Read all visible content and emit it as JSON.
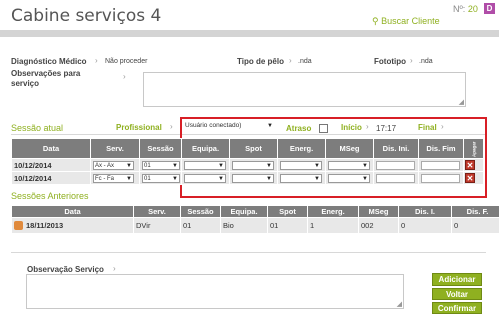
{
  "header": {
    "title": "Cabine serviços 4",
    "search_label": "Buscar Cliente",
    "no_label": "Nº:",
    "no_value": "20",
    "badge": "D"
  },
  "info": {
    "diag_label": "Diagnóstico Médico",
    "diag_value": "Não proceder",
    "tipo_label": "Tipo de pêlo",
    "tipo_value": ".nda",
    "foto_label": "Fototipo",
    "foto_value": ".nda",
    "obs_label_1": "Observações para",
    "obs_label_2": "serviço"
  },
  "session": {
    "title": "Sessão atual",
    "professional_label": "Profissional",
    "user_select": "Usuário conectado)",
    "atraso_label": "Atraso",
    "inicio_label": "Início",
    "inicio_time": "17:17",
    "final_label": "Final",
    "columns": [
      "Data",
      "Serv.",
      "Sessão",
      "Equipa.",
      "Spot",
      "Energ.",
      "MSeg",
      "Dis. Ini.",
      "Dis. Fim",
      "Apagar"
    ],
    "rows": [
      {
        "date": "10/12/2014",
        "serv": "Ax - Ax",
        "sessao": "01"
      },
      {
        "date": "10/12/2014",
        "serv": "Fc - Fa",
        "sessao": "01"
      }
    ]
  },
  "previous": {
    "title": "Sessões Anteriores",
    "columns": [
      "Data",
      "Serv.",
      "Sessão",
      "Equipa.",
      "Spot",
      "Energ.",
      "MSeg",
      "Dis. I.",
      "Dis. F."
    ],
    "rows": [
      {
        "data": "18/11/2013",
        "serv": "DVir",
        "sessao": "01",
        "equipa": "Bio",
        "spot": "01",
        "energ": "1",
        "mseg": "002",
        "dis_i": "0",
        "dis_f": "0"
      }
    ]
  },
  "obs_servico_label": "Observação Serviço",
  "buttons": {
    "adicionar": "Adicionar",
    "voltar": "Voltar",
    "confirmar": "Confirmar"
  },
  "colors": {
    "accent": "#8fb020",
    "highlight": "#d81f26",
    "badge": "#b04da8"
  }
}
